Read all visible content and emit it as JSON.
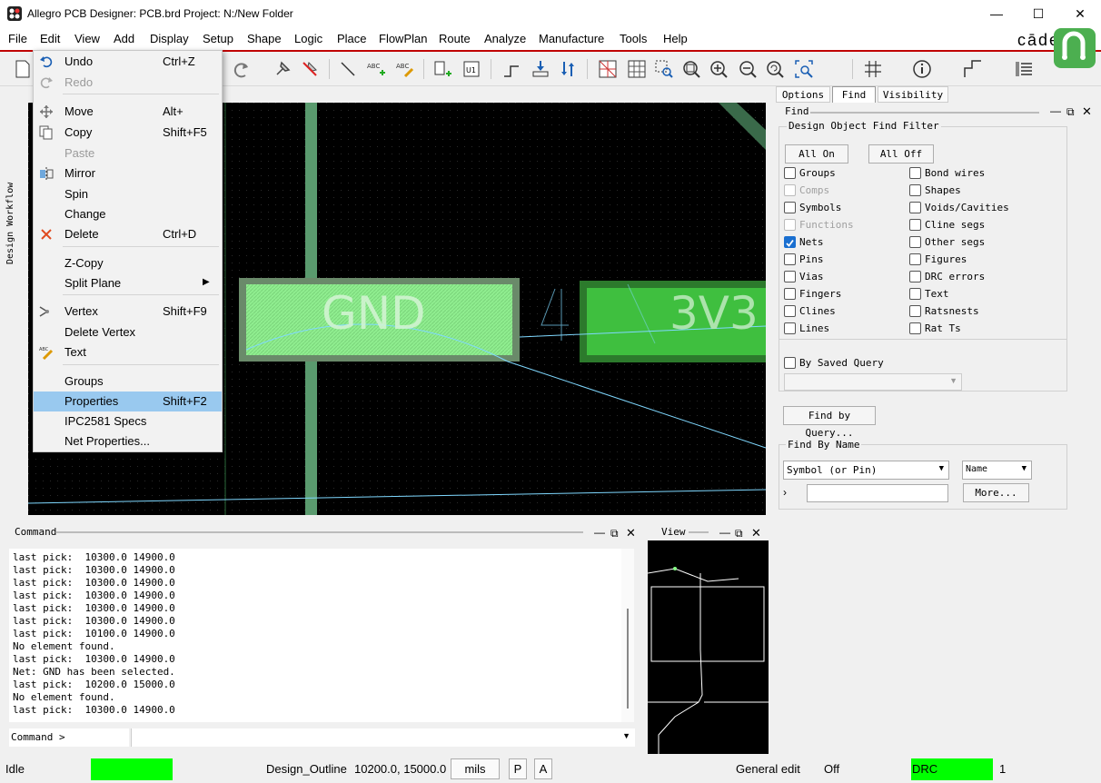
{
  "window": {
    "title": "Allegro PCB Designer: PCB.brd  Project: N:/New Folder",
    "brand": "cāde"
  },
  "menubar": [
    "File",
    "Edit",
    "View",
    "Add",
    "Display",
    "Setup",
    "Shape",
    "Logic",
    "Place",
    "FlowPlan",
    "Route",
    "Analyze",
    "Manufacture",
    "Tools",
    "Help"
  ],
  "edit_menu": {
    "items": [
      {
        "label": "Undo",
        "shortcut": "Ctrl+Z",
        "icon": "undo-icon",
        "disabled": false
      },
      {
        "label": "Redo",
        "shortcut": "",
        "icon": "redo-icon",
        "disabled": true
      },
      {
        "label": "Move",
        "shortcut": "Alt+",
        "icon": "move-icon",
        "disabled": false
      },
      {
        "label": "Copy",
        "shortcut": "Shift+F5",
        "icon": "copy-icon",
        "disabled": false
      },
      {
        "label": "Paste",
        "shortcut": "",
        "icon": "",
        "disabled": true
      },
      {
        "label": "Mirror",
        "shortcut": "",
        "icon": "mirror-icon",
        "disabled": false
      },
      {
        "label": "Spin",
        "shortcut": "",
        "icon": "",
        "disabled": false
      },
      {
        "label": "Change",
        "shortcut": "",
        "icon": "",
        "disabled": false
      },
      {
        "label": "Delete",
        "shortcut": "Ctrl+D",
        "icon": "delete-icon",
        "disabled": false
      },
      {
        "label": "Z-Copy",
        "shortcut": "",
        "icon": "",
        "disabled": false
      },
      {
        "label": "Split Plane",
        "shortcut": "",
        "icon": "",
        "disabled": false,
        "submenu": true
      },
      {
        "label": "Vertex",
        "shortcut": "Shift+F9",
        "icon": "vertex-icon",
        "disabled": false
      },
      {
        "label": "Delete Vertex",
        "shortcut": "",
        "icon": "",
        "disabled": false
      },
      {
        "label": "Text",
        "shortcut": "",
        "icon": "text-edit-icon",
        "disabled": false
      },
      {
        "label": "Groups",
        "shortcut": "",
        "icon": "",
        "disabled": false
      },
      {
        "label": "Properties",
        "shortcut": "Shift+F2",
        "icon": "",
        "disabled": false,
        "highlighted": true
      },
      {
        "label": "IPC2581 Specs",
        "shortcut": "",
        "icon": "",
        "disabled": false
      },
      {
        "label": "Net Properties...",
        "shortcut": "",
        "icon": "",
        "disabled": false
      }
    ]
  },
  "sidebar": {
    "workflow_label": "Design Workflow"
  },
  "canvas": {
    "pad_left_label": "GND",
    "pad_right_label": "3V3",
    "pad_left_color": "#90ee90",
    "pad_right_color": "#3fbf3f",
    "ratsnest_color": "#7fd8ff"
  },
  "right_panel": {
    "tabs": [
      "Options",
      "Find",
      "Visibility"
    ],
    "active_tab": "Find",
    "find_header": "Find",
    "filter_title": "Design Object Find Filter",
    "all_on": "All On",
    "all_off": "All Off",
    "left_checks": [
      {
        "label": "Groups",
        "checked": false,
        "disabled": false
      },
      {
        "label": "Comps",
        "checked": false,
        "disabled": true
      },
      {
        "label": "Symbols",
        "checked": false,
        "disabled": false
      },
      {
        "label": "Functions",
        "checked": false,
        "disabled": true
      },
      {
        "label": "Nets",
        "checked": true,
        "disabled": false
      },
      {
        "label": "Pins",
        "checked": false,
        "disabled": false
      },
      {
        "label": "Vias",
        "checked": false,
        "disabled": false
      },
      {
        "label": "Fingers",
        "checked": false,
        "disabled": false
      },
      {
        "label": "Clines",
        "checked": false,
        "disabled": false
      },
      {
        "label": "Lines",
        "checked": false,
        "disabled": false
      }
    ],
    "right_checks": [
      {
        "label": "Bond wires",
        "checked": false
      },
      {
        "label": "Shapes",
        "checked": false
      },
      {
        "label": "Voids/Cavities",
        "checked": false
      },
      {
        "label": "Cline segs",
        "checked": false
      },
      {
        "label": "Other segs",
        "checked": false
      },
      {
        "label": "Figures",
        "checked": false
      },
      {
        "label": "DRC errors",
        "checked": false
      },
      {
        "label": "Text",
        "checked": false
      },
      {
        "label": "Ratsnests",
        "checked": false
      },
      {
        "label": "Rat Ts",
        "checked": false
      }
    ],
    "saved_query_label": "By Saved Query",
    "find_by_query": "Find by Query...",
    "find_by_name_title": "Find By Name",
    "name_type": "Symbol (or Pin)",
    "name_mode": "Name",
    "name_value": "",
    "more": "More..."
  },
  "command": {
    "title": "Command",
    "log": [
      "last pick:  10300.0 14900.0",
      "last pick:  10300.0 14900.0",
      "last pick:  10300.0 14900.0",
      "last pick:  10300.0 14900.0",
      "last pick:  10300.0 14900.0",
      "last pick:  10300.0 14900.0",
      "last pick:  10100.0 14900.0",
      "No element found.",
      "last pick:  10300.0 14900.0",
      "Net: GND has been selected.",
      "last pick:  10200.0 15000.0",
      "No element found.",
      "last pick:  10300.0 14900.0"
    ],
    "prompt": "Command >"
  },
  "view": {
    "title": "View"
  },
  "status": {
    "state": "Idle",
    "subclass": "Design_Outline",
    "coords": "10200.0, 15000.0",
    "units": "mils",
    "p_btn": "P",
    "a_btn": "A",
    "mode": "General edit",
    "off": "Off",
    "drc": "DRC",
    "drc_count": "1",
    "indicator_color": "#00ff00"
  }
}
